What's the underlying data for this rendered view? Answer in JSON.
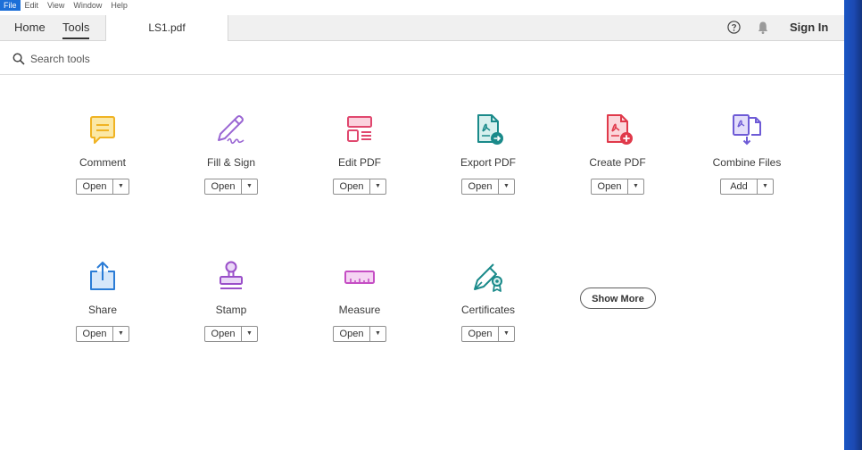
{
  "menubar": {
    "items": [
      "File",
      "Edit",
      "View",
      "Window",
      "Help"
    ]
  },
  "tabs": {
    "home": "Home",
    "tools": "Tools",
    "document": "LS1.pdf"
  },
  "header": {
    "sign_in": "Sign In",
    "help_icon": "help-circle-icon",
    "bell_icon": "bell-icon"
  },
  "search": {
    "placeholder": "Search tools",
    "value": ""
  },
  "tools": [
    {
      "name": "Comment",
      "button": "Open",
      "icon": "comment-icon",
      "color": "#f0b323"
    },
    {
      "name": "Fill & Sign",
      "button": "Open",
      "icon": "fill-sign-icon",
      "color": "#9a66d3"
    },
    {
      "name": "Edit PDF",
      "button": "Open",
      "icon": "edit-pdf-icon",
      "color": "#e0476e"
    },
    {
      "name": "Export PDF",
      "button": "Open",
      "icon": "export-pdf-icon",
      "color": "#1a8a8a"
    },
    {
      "name": "Create PDF",
      "button": "Open",
      "icon": "create-pdf-icon",
      "color": "#e0394a"
    },
    {
      "name": "Combine Files",
      "button": "Add",
      "icon": "combine-files-icon",
      "color": "#6e5bd6"
    },
    {
      "name": "Share",
      "button": "Open",
      "icon": "share-icon",
      "color": "#2b7cd6"
    },
    {
      "name": "Stamp",
      "button": "Open",
      "icon": "stamp-icon",
      "color": "#9a4fc9"
    },
    {
      "name": "Measure",
      "button": "Open",
      "icon": "measure-icon",
      "color": "#c54ec4"
    },
    {
      "name": "Certificates",
      "button": "Open",
      "icon": "certificates-icon",
      "color": "#1a8a8a"
    }
  ],
  "show_more": "Show More"
}
